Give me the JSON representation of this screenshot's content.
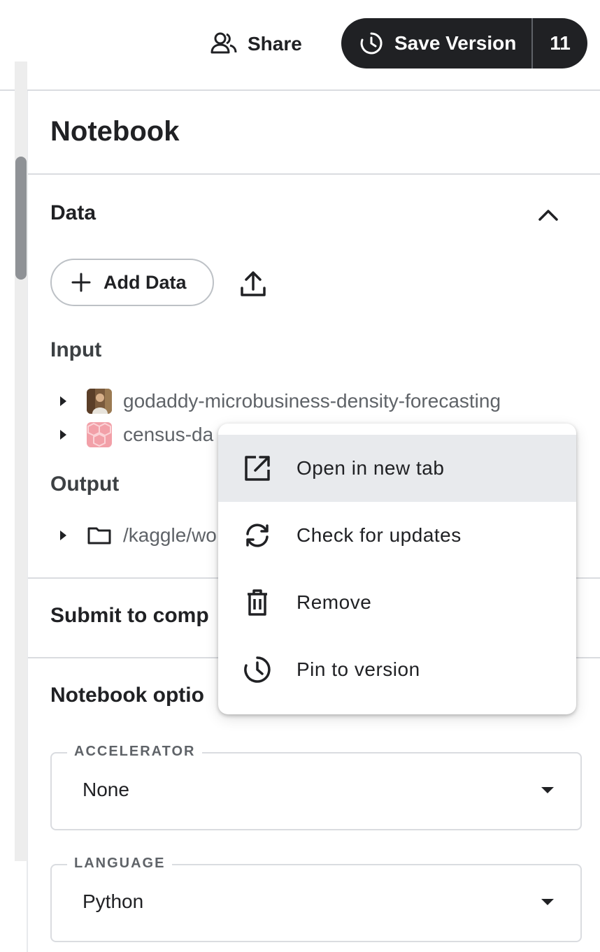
{
  "header": {
    "share_label": "Share",
    "save_version_label": "Save Version",
    "version_count": "11"
  },
  "panel": {
    "title": "Notebook",
    "data_section": {
      "title": "Data",
      "add_data_label": "Add Data",
      "input_title": "Input",
      "inputs": [
        {
          "name": "godaddy-microbusiness-density-forecasting",
          "icon": "dataset-thumbnail-icon"
        },
        {
          "name": "census-da",
          "icon": "pattern-thumbnail-icon"
        }
      ],
      "output_title": "Output",
      "outputs": [
        {
          "name": "/kaggle/wo",
          "icon": "folder-icon"
        }
      ]
    },
    "submit_section": {
      "title": "Submit to comp"
    },
    "options_section": {
      "title": "Notebook optio",
      "accelerator": {
        "label": "ACCELERATOR",
        "value": "None"
      },
      "language": {
        "label": "LANGUAGE",
        "value": "Python"
      }
    }
  },
  "context_menu": {
    "items": [
      {
        "label": "Open in new tab",
        "icon": "open-in-new-icon",
        "highlighted": true
      },
      {
        "label": "Check for updates",
        "icon": "sync-icon",
        "highlighted": false
      },
      {
        "label": "Remove",
        "icon": "trash-icon",
        "highlighted": false
      },
      {
        "label": "Pin to version",
        "icon": "history-clock-icon",
        "highlighted": false
      }
    ]
  },
  "colors": {
    "primary_dark": "#202124",
    "secondary_text": "#5f6368",
    "border": "#dadce0",
    "menu_highlight": "#e8eaed"
  }
}
